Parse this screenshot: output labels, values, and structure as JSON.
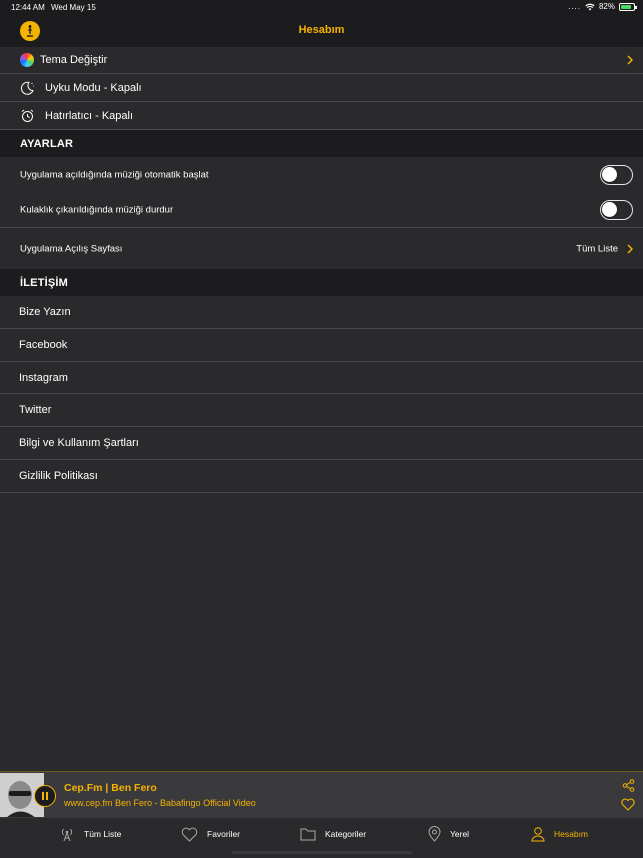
{
  "status_bar": {
    "time": "12:44 AM",
    "date": "Wed May 15",
    "battery": "82%",
    "battery_level": 0.82
  },
  "header": {
    "title": "Hesabım"
  },
  "menu": {
    "theme": "Tema Değiştir",
    "sleep": "Uyku Modu - Kapalı",
    "reminder": "Hatırlatıcı - Kapalı"
  },
  "settings": {
    "section_title": "AYARLAR",
    "autoplay_label": "Uygulama açıldığında müziği otomatik başlat",
    "autoplay_on": false,
    "headphone_label": "Kulaklık çıkarıldığında müziği durdur",
    "headphone_on": false,
    "start_page_label": "Uygulama Açılış Sayfası",
    "start_page_value": "Tüm Liste"
  },
  "contact": {
    "section_title": "İLETİŞİM",
    "items": [
      "Bize Yazın",
      "Facebook",
      "Instagram",
      "Twitter",
      "Bilgi ve Kullanım Şartları",
      "Gizlilik Politikası"
    ]
  },
  "player": {
    "station": "Cep.Fm | Ben Fero",
    "now_playing": "www.cep.fm Ben Fero - Babafingo Official Video"
  },
  "tabs": [
    "Tüm Liste",
    "Favoriler",
    "Kategoriler",
    "Yerel",
    "Hesabım"
  ],
  "active_tab": "Hesabım",
  "colors": {
    "accent": "#f5b301",
    "background": "#2a2a2c",
    "bar": "#1c1c1e"
  }
}
